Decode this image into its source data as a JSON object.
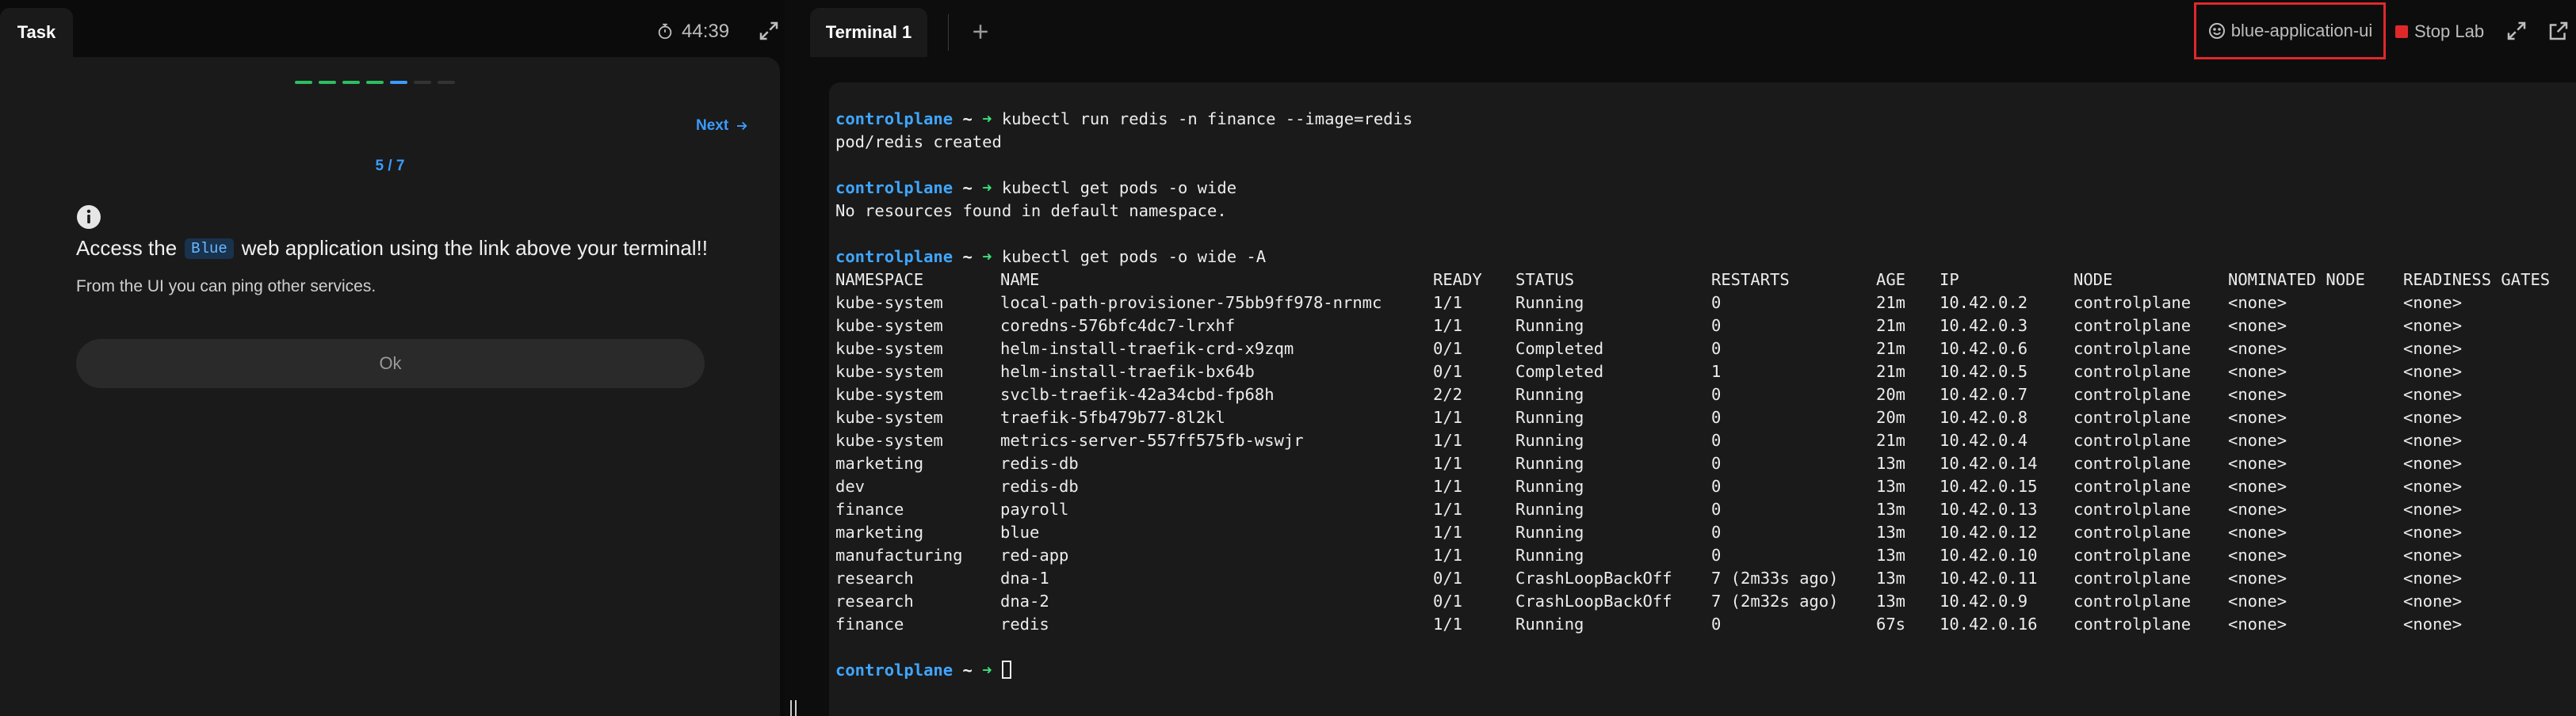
{
  "left_panel": {
    "tab_label": "Task",
    "timer": "44:39",
    "progress": {
      "completed": 4,
      "current": 5,
      "total": 7
    },
    "progress_colors": {
      "done": "#2ebd5f",
      "current": "#3b9cff",
      "todo": "#333333"
    },
    "next_label": "Next",
    "step_label": "5 / 7",
    "task": {
      "prefix": "Access the",
      "code": "Blue",
      "suffix": "web application using the link above your terminal!!",
      "sub": "From the UI you can ping other services."
    },
    "ok_label": "Ok"
  },
  "topbar": {
    "terminal_tab": "Terminal 1",
    "app_link_label": "blue-application-ui",
    "stop_label": "Stop Lab",
    "accent_red": "#e0282b"
  },
  "terminal": {
    "prompt_host": "controlplane",
    "prompt_dir": "~",
    "blocks": [
      {
        "command": "kubectl run redis -n finance --image=redis",
        "output": [
          "pod/redis created"
        ]
      },
      {
        "command": "kubectl get pods -o wide",
        "output": [
          "No resources found in default namespace."
        ]
      }
    ],
    "table_command": "kubectl get pods -o wide -A",
    "table_headers": [
      "NAMESPACE",
      "NAME",
      "READY",
      "STATUS",
      "RESTARTS",
      "AGE",
      "IP",
      "NODE",
      "NOMINATED NODE",
      "READINESS GATES"
    ],
    "table_rows": [
      [
        "kube-system",
        "local-path-provisioner-75bb9ff978-nrnmc",
        "1/1",
        "Running",
        "0",
        "21m",
        "10.42.0.2",
        "controlplane",
        "<none>",
        "<none>"
      ],
      [
        "kube-system",
        "coredns-576bfc4dc7-lrxhf",
        "1/1",
        "Running",
        "0",
        "21m",
        "10.42.0.3",
        "controlplane",
        "<none>",
        "<none>"
      ],
      [
        "kube-system",
        "helm-install-traefik-crd-x9zqm",
        "0/1",
        "Completed",
        "0",
        "21m",
        "10.42.0.6",
        "controlplane",
        "<none>",
        "<none>"
      ],
      [
        "kube-system",
        "helm-install-traefik-bx64b",
        "0/1",
        "Completed",
        "1",
        "21m",
        "10.42.0.5",
        "controlplane",
        "<none>",
        "<none>"
      ],
      [
        "kube-system",
        "svclb-traefik-42a34cbd-fp68h",
        "2/2",
        "Running",
        "0",
        "20m",
        "10.42.0.7",
        "controlplane",
        "<none>",
        "<none>"
      ],
      [
        "kube-system",
        "traefik-5fb479b77-8l2kl",
        "1/1",
        "Running",
        "0",
        "20m",
        "10.42.0.8",
        "controlplane",
        "<none>",
        "<none>"
      ],
      [
        "kube-system",
        "metrics-server-557ff575fb-wswjr",
        "1/1",
        "Running",
        "0",
        "21m",
        "10.42.0.4",
        "controlplane",
        "<none>",
        "<none>"
      ],
      [
        "marketing",
        "redis-db",
        "1/1",
        "Running",
        "0",
        "13m",
        "10.42.0.14",
        "controlplane",
        "<none>",
        "<none>"
      ],
      [
        "dev",
        "redis-db",
        "1/1",
        "Running",
        "0",
        "13m",
        "10.42.0.15",
        "controlplane",
        "<none>",
        "<none>"
      ],
      [
        "finance",
        "payroll",
        "1/1",
        "Running",
        "0",
        "13m",
        "10.42.0.13",
        "controlplane",
        "<none>",
        "<none>"
      ],
      [
        "marketing",
        "blue",
        "1/1",
        "Running",
        "0",
        "13m",
        "10.42.0.12",
        "controlplane",
        "<none>",
        "<none>"
      ],
      [
        "manufacturing",
        "red-app",
        "1/1",
        "Running",
        "0",
        "13m",
        "10.42.0.10",
        "controlplane",
        "<none>",
        "<none>"
      ],
      [
        "research",
        "dna-1",
        "0/1",
        "CrashLoopBackOff",
        "7 (2m33s ago)",
        "13m",
        "10.42.0.11",
        "controlplane",
        "<none>",
        "<none>"
      ],
      [
        "research",
        "dna-2",
        "0/1",
        "CrashLoopBackOff",
        "7 (2m32s ago)",
        "13m",
        "10.42.0.9",
        "controlplane",
        "<none>",
        "<none>"
      ],
      [
        "finance",
        "redis",
        "1/1",
        "Running",
        "0",
        "67s",
        "10.42.0.16",
        "controlplane",
        "<none>",
        "<none>"
      ]
    ]
  }
}
